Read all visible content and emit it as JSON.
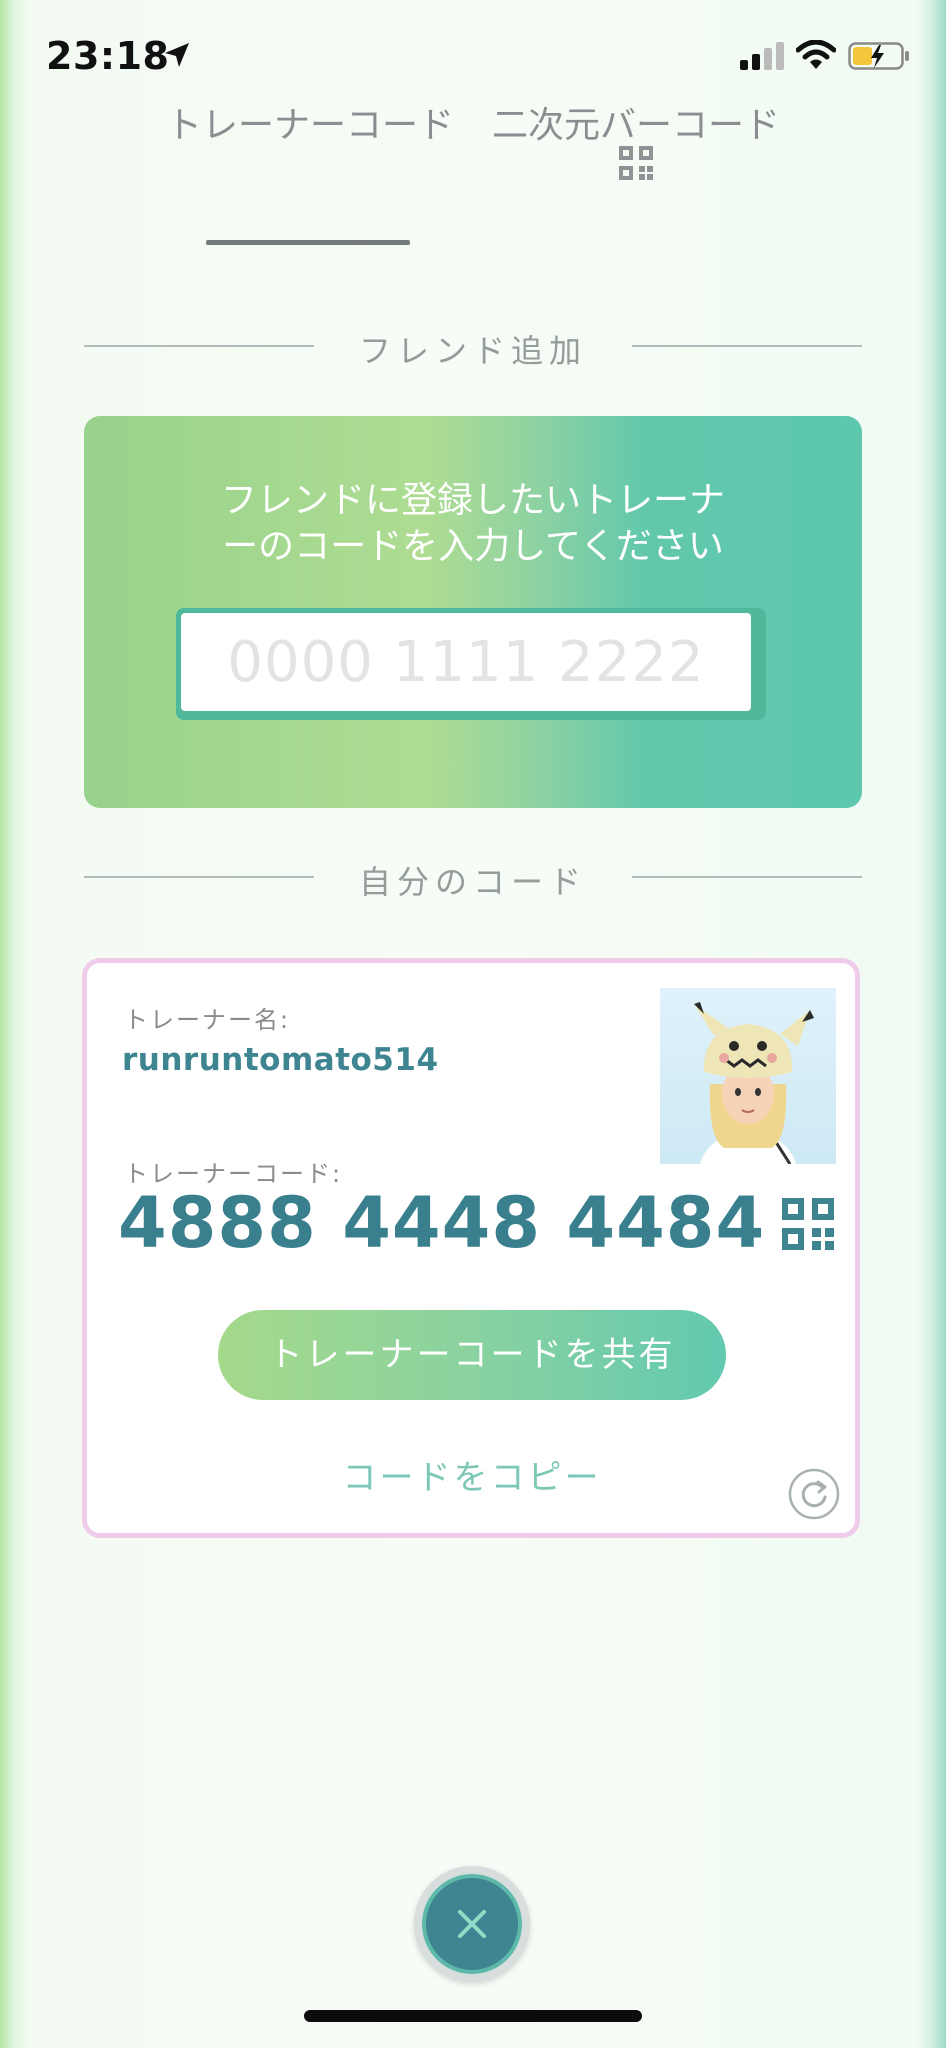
{
  "status_bar": {
    "time": "23:18"
  },
  "tabs": [
    {
      "label": "トレーナーコード",
      "active": true
    },
    {
      "label": "二次元バーコード",
      "icon": "qr-code-icon"
    }
  ],
  "add_friend": {
    "section_title": "フレンド追加",
    "instruction": "フレンドに登録したいトレーナ\nーのコードを入力してください",
    "input_value": "",
    "input_placeholder": "0000 1111 2222"
  },
  "my_code": {
    "section_title": "自分のコード",
    "name_label": "トレーナー名:",
    "name": "runruntomato514",
    "code_label": "トレーナーコード:",
    "code": "4888 4448 4484",
    "share_label": "トレーナーコードを共有",
    "copy_label": "コードをコピー"
  },
  "colors": {
    "accent_teal": "#3a7f8d",
    "panel_green": "#aedc92",
    "panel_teal": "#5dc8ae",
    "card_border_pink": "#efcdea"
  },
  "icons": [
    "location-arrow-icon",
    "signal-icon",
    "wifi-icon",
    "battery-charging-icon",
    "qr-code-icon",
    "refresh-icon",
    "close-icon"
  ]
}
